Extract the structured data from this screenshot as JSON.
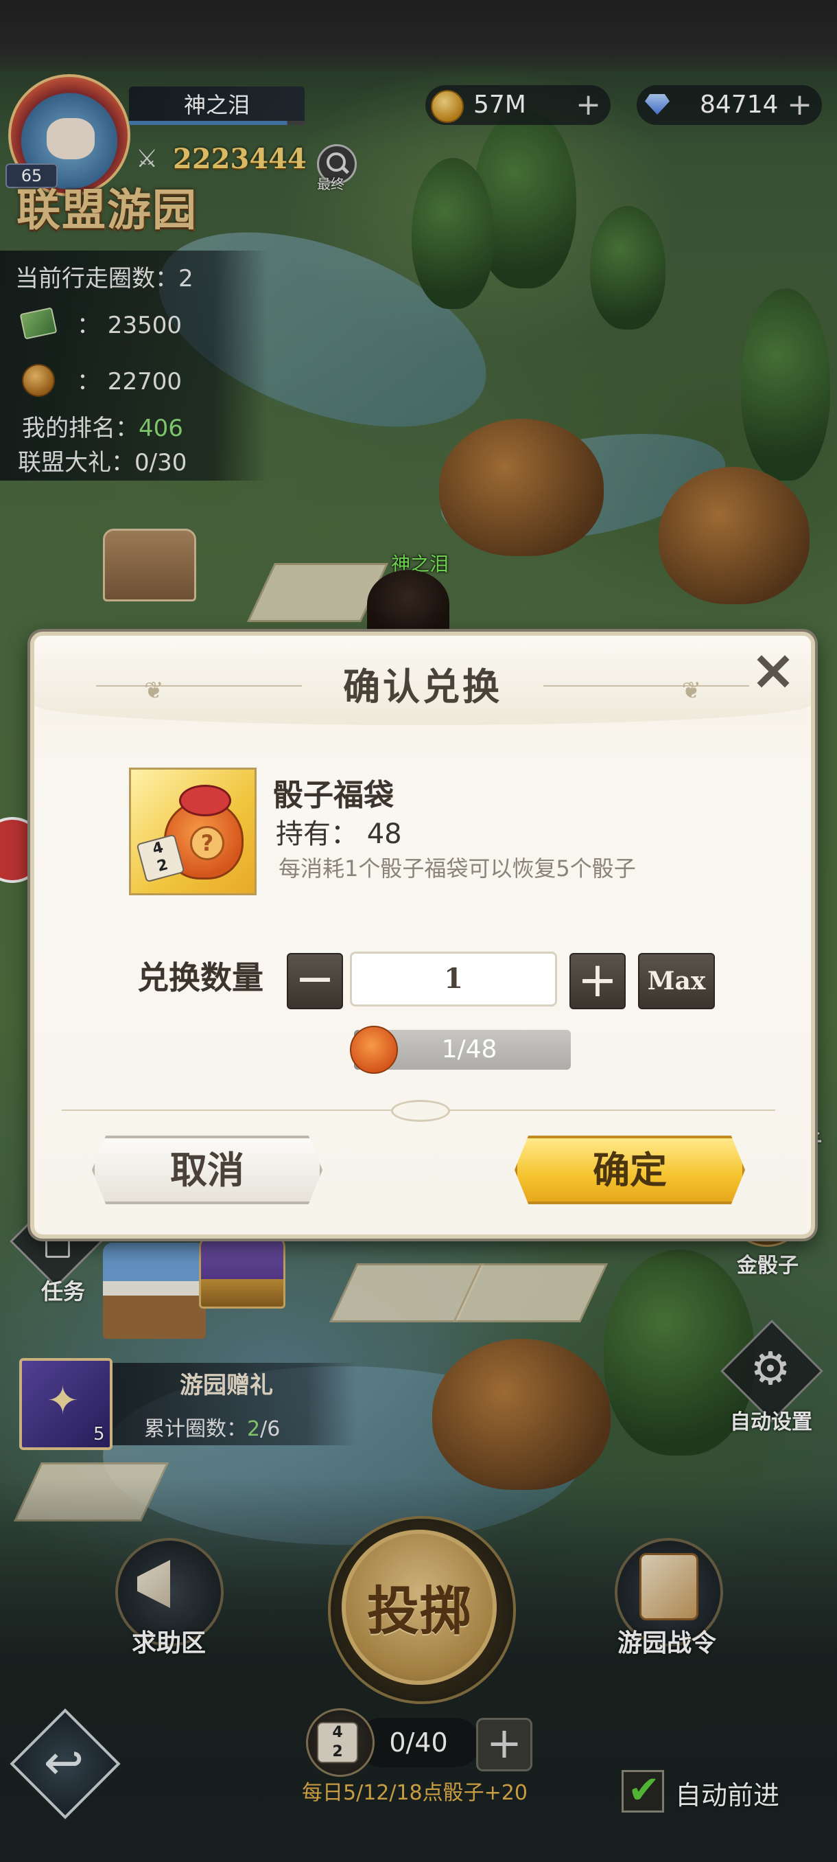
{
  "player": {
    "level": "65",
    "name": "神之泪",
    "power": "2223444",
    "search_label": "最终"
  },
  "resources": {
    "coins": "57M",
    "gems": "84714",
    "plus": "+"
  },
  "event": {
    "title": "联盟游园",
    "laps_label": "当前行走圈数：",
    "laps_value": "2",
    "cash_value": "：  23500",
    "gold_value": "：  22700",
    "rank_label": "我的排名：",
    "rank_value": "406",
    "gift_label": "联盟大礼：",
    "gift_value": "0/30"
  },
  "map": {
    "player_tag": "神之泪",
    "task_label": "任务",
    "gold_dice_label": "金骰子",
    "right_edge_label": "子",
    "auto_settings_label": "自动设置",
    "gift": {
      "title": "游园赠礼",
      "card_count": "5",
      "progress_label": "累计圈数：",
      "progress_current": "2",
      "progress_total": "/6"
    }
  },
  "bottom": {
    "help_label": "求助区",
    "roll_label": "投掷",
    "pass_label": "游园战令",
    "dice_count": "0/40",
    "dice_plus": "+",
    "dice_hint": "每日5/12/18点骰子+20",
    "auto_forward_label": "自动前进",
    "auto_forward_checked": true
  },
  "dialog": {
    "title": "确认兑换",
    "close": "×",
    "item": {
      "name": "骰子福袋",
      "own_label": "持有：",
      "own_value": "48",
      "description": "每消耗1个骰子福袋可以恢复5个骰子"
    },
    "quantity": {
      "label": "兑换数量",
      "minus": "−",
      "value": "1",
      "plus": "+",
      "max": "Max"
    },
    "progress": {
      "text": "1/48",
      "current": 1,
      "total": 48
    },
    "cancel_label": "取消",
    "confirm_label": "确定"
  },
  "colors": {
    "confirm_button": "#f5c32e",
    "progress_green": "#8fe07a",
    "dice_hint": "#e6b24c"
  }
}
